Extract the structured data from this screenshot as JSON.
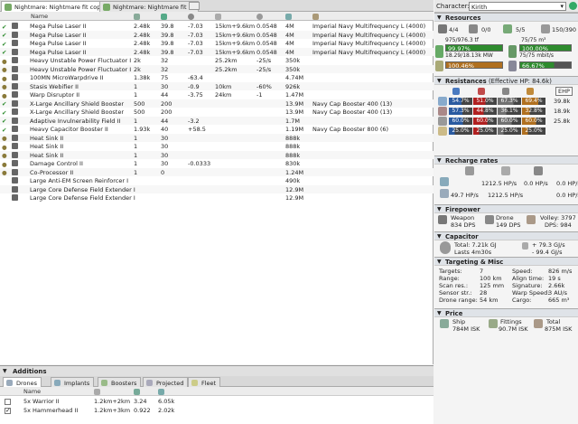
{
  "tabs": [
    {
      "label": "Nightmare: Nightmare fit copy",
      "close": "x"
    },
    {
      "label": "Nightmare: Nightmare fit",
      "close": "x"
    }
  ],
  "grid": {
    "name_header": "Name",
    "rows": [
      {
        "state": "✔",
        "name": "Mega Pulse Laser II",
        "c1": "2.48k",
        "c2": "39.8",
        "c3": "-7.03",
        "c4": "15km+9.6km",
        "c5": "0.0548",
        "c6": "4M",
        "c7": "Imperial Navy Multifrequency L (4000)"
      },
      {
        "state": "✔",
        "name": "Mega Pulse Laser II",
        "c1": "2.48k",
        "c2": "39.8",
        "c3": "-7.03",
        "c4": "15km+9.6km",
        "c5": "0.0548",
        "c6": "4M",
        "c7": "Imperial Navy Multifrequency L (4000)"
      },
      {
        "state": "✔",
        "name": "Mega Pulse Laser II",
        "c1": "2.48k",
        "c2": "39.8",
        "c3": "-7.03",
        "c4": "15km+9.6km",
        "c5": "0.0548",
        "c6": "4M",
        "c7": "Imperial Navy Multifrequency L (4000)"
      },
      {
        "state": "✔",
        "name": "Mega Pulse Laser II",
        "c1": "2.48k",
        "c2": "39.8",
        "c3": "-7.03",
        "c4": "15km+9.6km",
        "c5": "0.0548",
        "c6": "4M",
        "c7": "Imperial Navy Multifrequency L (4000)"
      },
      {
        "state": "●",
        "name": "Heavy Unstable Power Fluctuator I",
        "c1": "2k",
        "c2": "32",
        "c3": "",
        "c4": "25.2km",
        "c5": "-25/s",
        "c6": "350k",
        "c7": ""
      },
      {
        "state": "●",
        "name": "Heavy Unstable Power Fluctuator I",
        "c1": "2k",
        "c2": "32",
        "c3": "",
        "c4": "25.2km",
        "c5": "-25/s",
        "c6": "350k",
        "c7": ""
      },
      {
        "state": "●",
        "name": "100MN MicroWarpdrive II",
        "c1": "1.38k",
        "c2": "75",
        "c3": "-63.4",
        "c4": "",
        "c5": "",
        "c6": "4.74M",
        "c7": ""
      },
      {
        "state": "●",
        "name": "Stasis Webifier II",
        "c1": "1",
        "c2": "30",
        "c3": "-0.9",
        "c4": "10km",
        "c5": "-60%",
        "c6": "926k",
        "c7": ""
      },
      {
        "state": "●",
        "name": "Warp Disruptor II",
        "c1": "1",
        "c2": "44",
        "c3": "-3.75",
        "c4": "24km",
        "c5": "-1",
        "c6": "1.47M",
        "c7": ""
      },
      {
        "state": "✔",
        "name": "X-Large Ancillary Shield Booster",
        "c1": "500",
        "c2": "200",
        "c3": "",
        "c4": "",
        "c5": "",
        "c6": "13.9M",
        "c7": "Navy Cap Booster 400 (13)"
      },
      {
        "state": "✔",
        "name": "X-Large Ancillary Shield Booster",
        "c1": "500",
        "c2": "200",
        "c3": "",
        "c4": "",
        "c5": "",
        "c6": "13.9M",
        "c7": "Navy Cap Booster 400 (13)"
      },
      {
        "state": "✔",
        "name": "Adaptive Invulnerability Field II",
        "c1": "1",
        "c2": "44",
        "c3": "-3.2",
        "c4": "",
        "c5": "",
        "c6": "1.7M",
        "c7": ""
      },
      {
        "state": "✔",
        "name": "Heavy Capacitor Booster II",
        "c1": "1.93k",
        "c2": "40",
        "c3": "+58.5",
        "c4": "",
        "c5": "",
        "c6": "1.19M",
        "c7": "Navy Cap Booster 800 (6)"
      },
      {
        "state": "●",
        "name": "Heat Sink II",
        "c1": "1",
        "c2": "30",
        "c3": "",
        "c4": "",
        "c5": "",
        "c6": "888k",
        "c7": ""
      },
      {
        "state": "●",
        "name": "Heat Sink II",
        "c1": "1",
        "c2": "30",
        "c3": "",
        "c4": "",
        "c5": "",
        "c6": "888k",
        "c7": ""
      },
      {
        "state": "●",
        "name": "Heat Sink II",
        "c1": "1",
        "c2": "30",
        "c3": "",
        "c4": "",
        "c5": "",
        "c6": "888k",
        "c7": ""
      },
      {
        "state": "●",
        "name": "Damage Control II",
        "c1": "1",
        "c2": "30",
        "c3": "-0.0333",
        "c4": "",
        "c5": "",
        "c6": "830k",
        "c7": ""
      },
      {
        "state": "●",
        "name": "Co-Processor II",
        "c1": "1",
        "c2": "0",
        "c3": "",
        "c4": "",
        "c5": "",
        "c6": "1.24M",
        "c7": ""
      },
      {
        "state": "",
        "name": "Large Anti-EM Screen Reinforcer I",
        "c1": "",
        "c2": "",
        "c3": "",
        "c4": "",
        "c5": "",
        "c6": "490k",
        "c7": ""
      },
      {
        "state": "",
        "name": "Large Core Defense Field Extender I",
        "c1": "",
        "c2": "",
        "c3": "",
        "c4": "",
        "c5": "",
        "c6": "12.9M",
        "c7": ""
      },
      {
        "state": "",
        "name": "Large Core Defense Field Extender I",
        "c1": "",
        "c2": "",
        "c3": "",
        "c4": "",
        "c5": "",
        "c6": "12.9M",
        "c7": ""
      }
    ]
  },
  "additions": {
    "title": "Additions",
    "tabs": [
      "Drones",
      "Implants",
      "Boosters",
      "Projected",
      "Fleet"
    ],
    "name_header": "Name",
    "rows": [
      {
        "name": "5x Warrior II",
        "range": "1.2km+2km",
        "speed": "3.24",
        "price": "6.05k"
      },
      {
        "name": "5x Hammerhead II",
        "range": "1.2km+3km",
        "speed": "0.922",
        "price": "2.02k"
      }
    ]
  },
  "character": {
    "label": "Character:",
    "value": "Kirith"
  },
  "resources": {
    "title": "Resources",
    "turrets": "4/4",
    "launchers": "0/0",
    "calibration": "5/5",
    "drones_active": "150/390",
    "drone_bay": "975/976.3 tf",
    "drone_bw": "75/75 m³",
    "cpu_pct": "99.97%",
    "cpu": "18.29/18.13k MW",
    "pg_pct": "100.00%",
    "pg": "75/75 mbit/s",
    "cal_pct": "100.46%",
    "bw_pct": "66.67%"
  },
  "resistances": {
    "title": "Resistances",
    "ehp_label": "(Effective HP: 84.6k)",
    "ehp_button": "EHP",
    "rows": [
      {
        "vals": [
          "54.7%",
          "51.0%",
          "67.3%",
          "69.4%"
        ],
        "hp": "39.8k"
      },
      {
        "vals": [
          "57.3%",
          "44.8%",
          "36.1%",
          "32.8%"
        ],
        "hp": "18.9k"
      },
      {
        "vals": [
          "60.0%",
          "60.0%",
          "60.0%",
          "60.0%"
        ],
        "hp": "25.8k"
      },
      {
        "vals": [
          "25.0%",
          "25.0%",
          "25.0%",
          "25.0%"
        ],
        "hp": ""
      }
    ]
  },
  "recharge": {
    "title": "Recharge rates",
    "rows": [
      {
        "a": "1212.5 HP/s",
        "b": "0.0 HP/s",
        "c": "0.0 HP/s"
      },
      {
        "a": "49.7 HP/s",
        "b": "1212.5 HP/s",
        "c": "0.0 HP/s"
      }
    ]
  },
  "firepower": {
    "title": "Firepower",
    "weapon_label": "Weapon",
    "weapon_val": "834 DPS",
    "drone_label": "Drone",
    "drone_val": "149 DPS",
    "volley_label": "Volley: 3797",
    "dps_label": "DPS: 984"
  },
  "capacitor": {
    "title": "Capacitor",
    "total": "Total: 7.21k GJ",
    "lasts": "Lasts 4m30s",
    "delta1": "+ 79.3 GJ/s",
    "delta2": "- 99.4 GJ/s"
  },
  "targeting": {
    "title": "Targeting & Misc",
    "left": [
      {
        "k": "Targets:",
        "v": "7"
      },
      {
        "k": "Range:",
        "v": "100 km"
      },
      {
        "k": "Scan res.:",
        "v": "125 mm"
      },
      {
        "k": "Sensor str.:",
        "v": "28"
      },
      {
        "k": "Drone range:",
        "v": "54 km"
      }
    ],
    "right": [
      {
        "k": "Speed:",
        "v": "826 m/s"
      },
      {
        "k": "Align time:",
        "v": "19 s"
      },
      {
        "k": "Signature:",
        "v": "2.66k"
      },
      {
        "k": "Warp Speed:",
        "v": "3 AU/s"
      },
      {
        "k": "Cargo:",
        "v": "665 m³"
      }
    ]
  },
  "price": {
    "title": "Price",
    "ship_label": "Ship",
    "ship_val": "784M ISK",
    "fit_label": "Fittings",
    "fit_val": "90.7M ISK",
    "total_label": "Total",
    "total_val": "875M ISK"
  },
  "colors": {
    "green": "#2e8b2e",
    "em": "#2a5aa0",
    "therm": "#b02020",
    "kin": "#707070",
    "expl": "#b07020"
  }
}
